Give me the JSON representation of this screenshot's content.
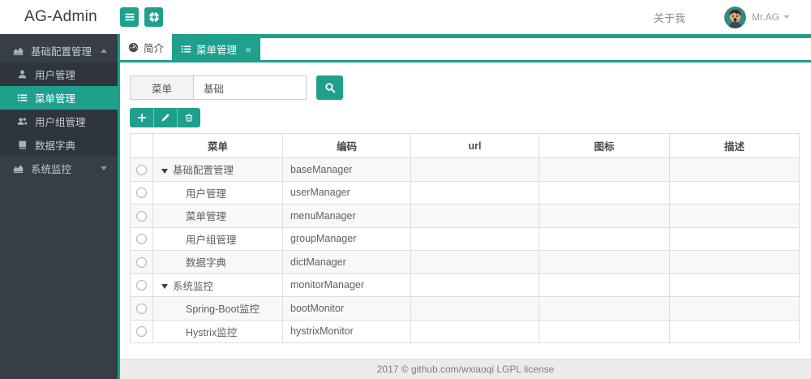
{
  "brand": "AG-Admin",
  "colors": {
    "accent_teal": "#1ea08c",
    "sidebar_bg": "#373e47",
    "sidebar_submenu_bg": "#2f353d"
  },
  "header": {
    "about_label": "关于我",
    "username": "Mr.AG",
    "buttons": [
      {
        "icon": "bars-icon"
      },
      {
        "icon": "life-ring-icon"
      }
    ]
  },
  "sidebar": {
    "items": [
      {
        "label": "基础配置管理",
        "icon": "chart",
        "type": "parent",
        "state": "expanded",
        "active": false
      },
      {
        "label": "用户管理",
        "icon": "user",
        "type": "child",
        "active": false
      },
      {
        "label": "菜单管理",
        "icon": "list",
        "type": "child",
        "active": true
      },
      {
        "label": "用户组管理",
        "icon": "users",
        "type": "child",
        "active": false
      },
      {
        "label": "数据字典",
        "icon": "book",
        "type": "child",
        "active": false
      },
      {
        "label": "系统监控",
        "icon": "chart",
        "type": "parent",
        "state": "collapsed",
        "active": false
      }
    ]
  },
  "tabs": [
    {
      "label": "简介",
      "icon": "gauge",
      "active": false,
      "closable": false
    },
    {
      "label": "菜单管理",
      "icon": "list",
      "active": true,
      "closable": true
    }
  ],
  "search": {
    "label": "菜单",
    "value": "基础"
  },
  "toolbar": {
    "buttons": [
      "add",
      "edit",
      "delete"
    ]
  },
  "menu_table": {
    "headers": [
      "",
      "菜单",
      "编码",
      "url",
      "图标",
      "描述"
    ],
    "rows": [
      {
        "name": "基础配置管理",
        "code": "baseManager",
        "url": "",
        "icon": "",
        "desc": "",
        "indent": 0,
        "caret": true
      },
      {
        "name": "用户管理",
        "code": "userManager",
        "url": "",
        "icon": "",
        "desc": "",
        "indent": 1,
        "caret": false
      },
      {
        "name": "菜单管理",
        "code": "menuManager",
        "url": "",
        "icon": "",
        "desc": "",
        "indent": 1,
        "caret": false
      },
      {
        "name": "用户组管理",
        "code": "groupManager",
        "url": "",
        "icon": "",
        "desc": "",
        "indent": 1,
        "caret": false
      },
      {
        "name": "数据字典",
        "code": "dictManager",
        "url": "",
        "icon": "",
        "desc": "",
        "indent": 1,
        "caret": false
      },
      {
        "name": "系统监控",
        "code": "monitorManager",
        "url": "",
        "icon": "",
        "desc": "",
        "indent": 0,
        "caret": true
      },
      {
        "name": "Spring-Boot监控",
        "code": "bootMonitor",
        "url": "",
        "icon": "",
        "desc": "",
        "indent": 1,
        "caret": false
      },
      {
        "name": "Hystrix监控",
        "code": "hystrixMonitor",
        "url": "",
        "icon": "",
        "desc": "",
        "indent": 1,
        "caret": false
      }
    ]
  },
  "glyphs": {
    "close": "×"
  },
  "footer": {
    "text": "2017 ©  github.com/wxiaoqi  LGPL license"
  }
}
